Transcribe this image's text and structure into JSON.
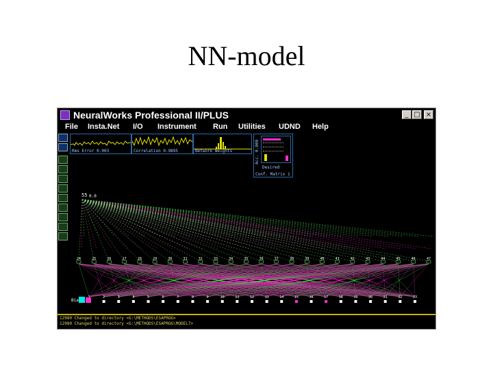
{
  "slide": {
    "title": "NN-model"
  },
  "app": {
    "title": "NeuralWorks Professional II/PLUS",
    "window_buttons": {
      "minimize": "_",
      "maximize": "□",
      "close": "×"
    }
  },
  "menu": [
    "File",
    "Insta.Net",
    "I/O",
    "Instrument",
    "Run",
    "Utilities",
    "UDND",
    "Help"
  ],
  "panels": {
    "rms_error": "Rms Error 0.003",
    "correlation": "Correlation 0.9895",
    "network_weights": "Network Weights",
    "accuracy": "Acc. 0.000",
    "desired": "Desired",
    "conf_matrix": "Conf. Matrix 1"
  },
  "network": {
    "top_node": "55",
    "top_node_suffix": "0.0",
    "hidden_labels": [
      "24",
      "25",
      "26",
      "27",
      "28",
      "29",
      "30",
      "31",
      "32",
      "33",
      "34",
      "35",
      "36",
      "37",
      "38",
      "39",
      "40",
      "41",
      "42",
      "43",
      "44",
      "45",
      "46",
      "47"
    ],
    "input_labels": [
      "1",
      "2",
      "3",
      "4",
      "5",
      "6",
      "7",
      "8",
      "9",
      "10",
      "11",
      "12",
      "13",
      "14",
      "15",
      "16",
      "17",
      "18",
      "19",
      "20",
      "21",
      "22",
      "23"
    ],
    "bias_label": "Bias"
  },
  "status": {
    "line1": "12980 Changed to directory <G:\\METHODS\\ESAPROG>",
    "line2": "12980 Changed to directory <G:\\METHODS\\ESAPROG\\MODEL7>"
  },
  "colors": {
    "accent_green": "#5ee85e",
    "accent_magenta": "#ff2fd0",
    "accent_yellow": "#e0e000",
    "panel_border": "#2c6aa8"
  }
}
